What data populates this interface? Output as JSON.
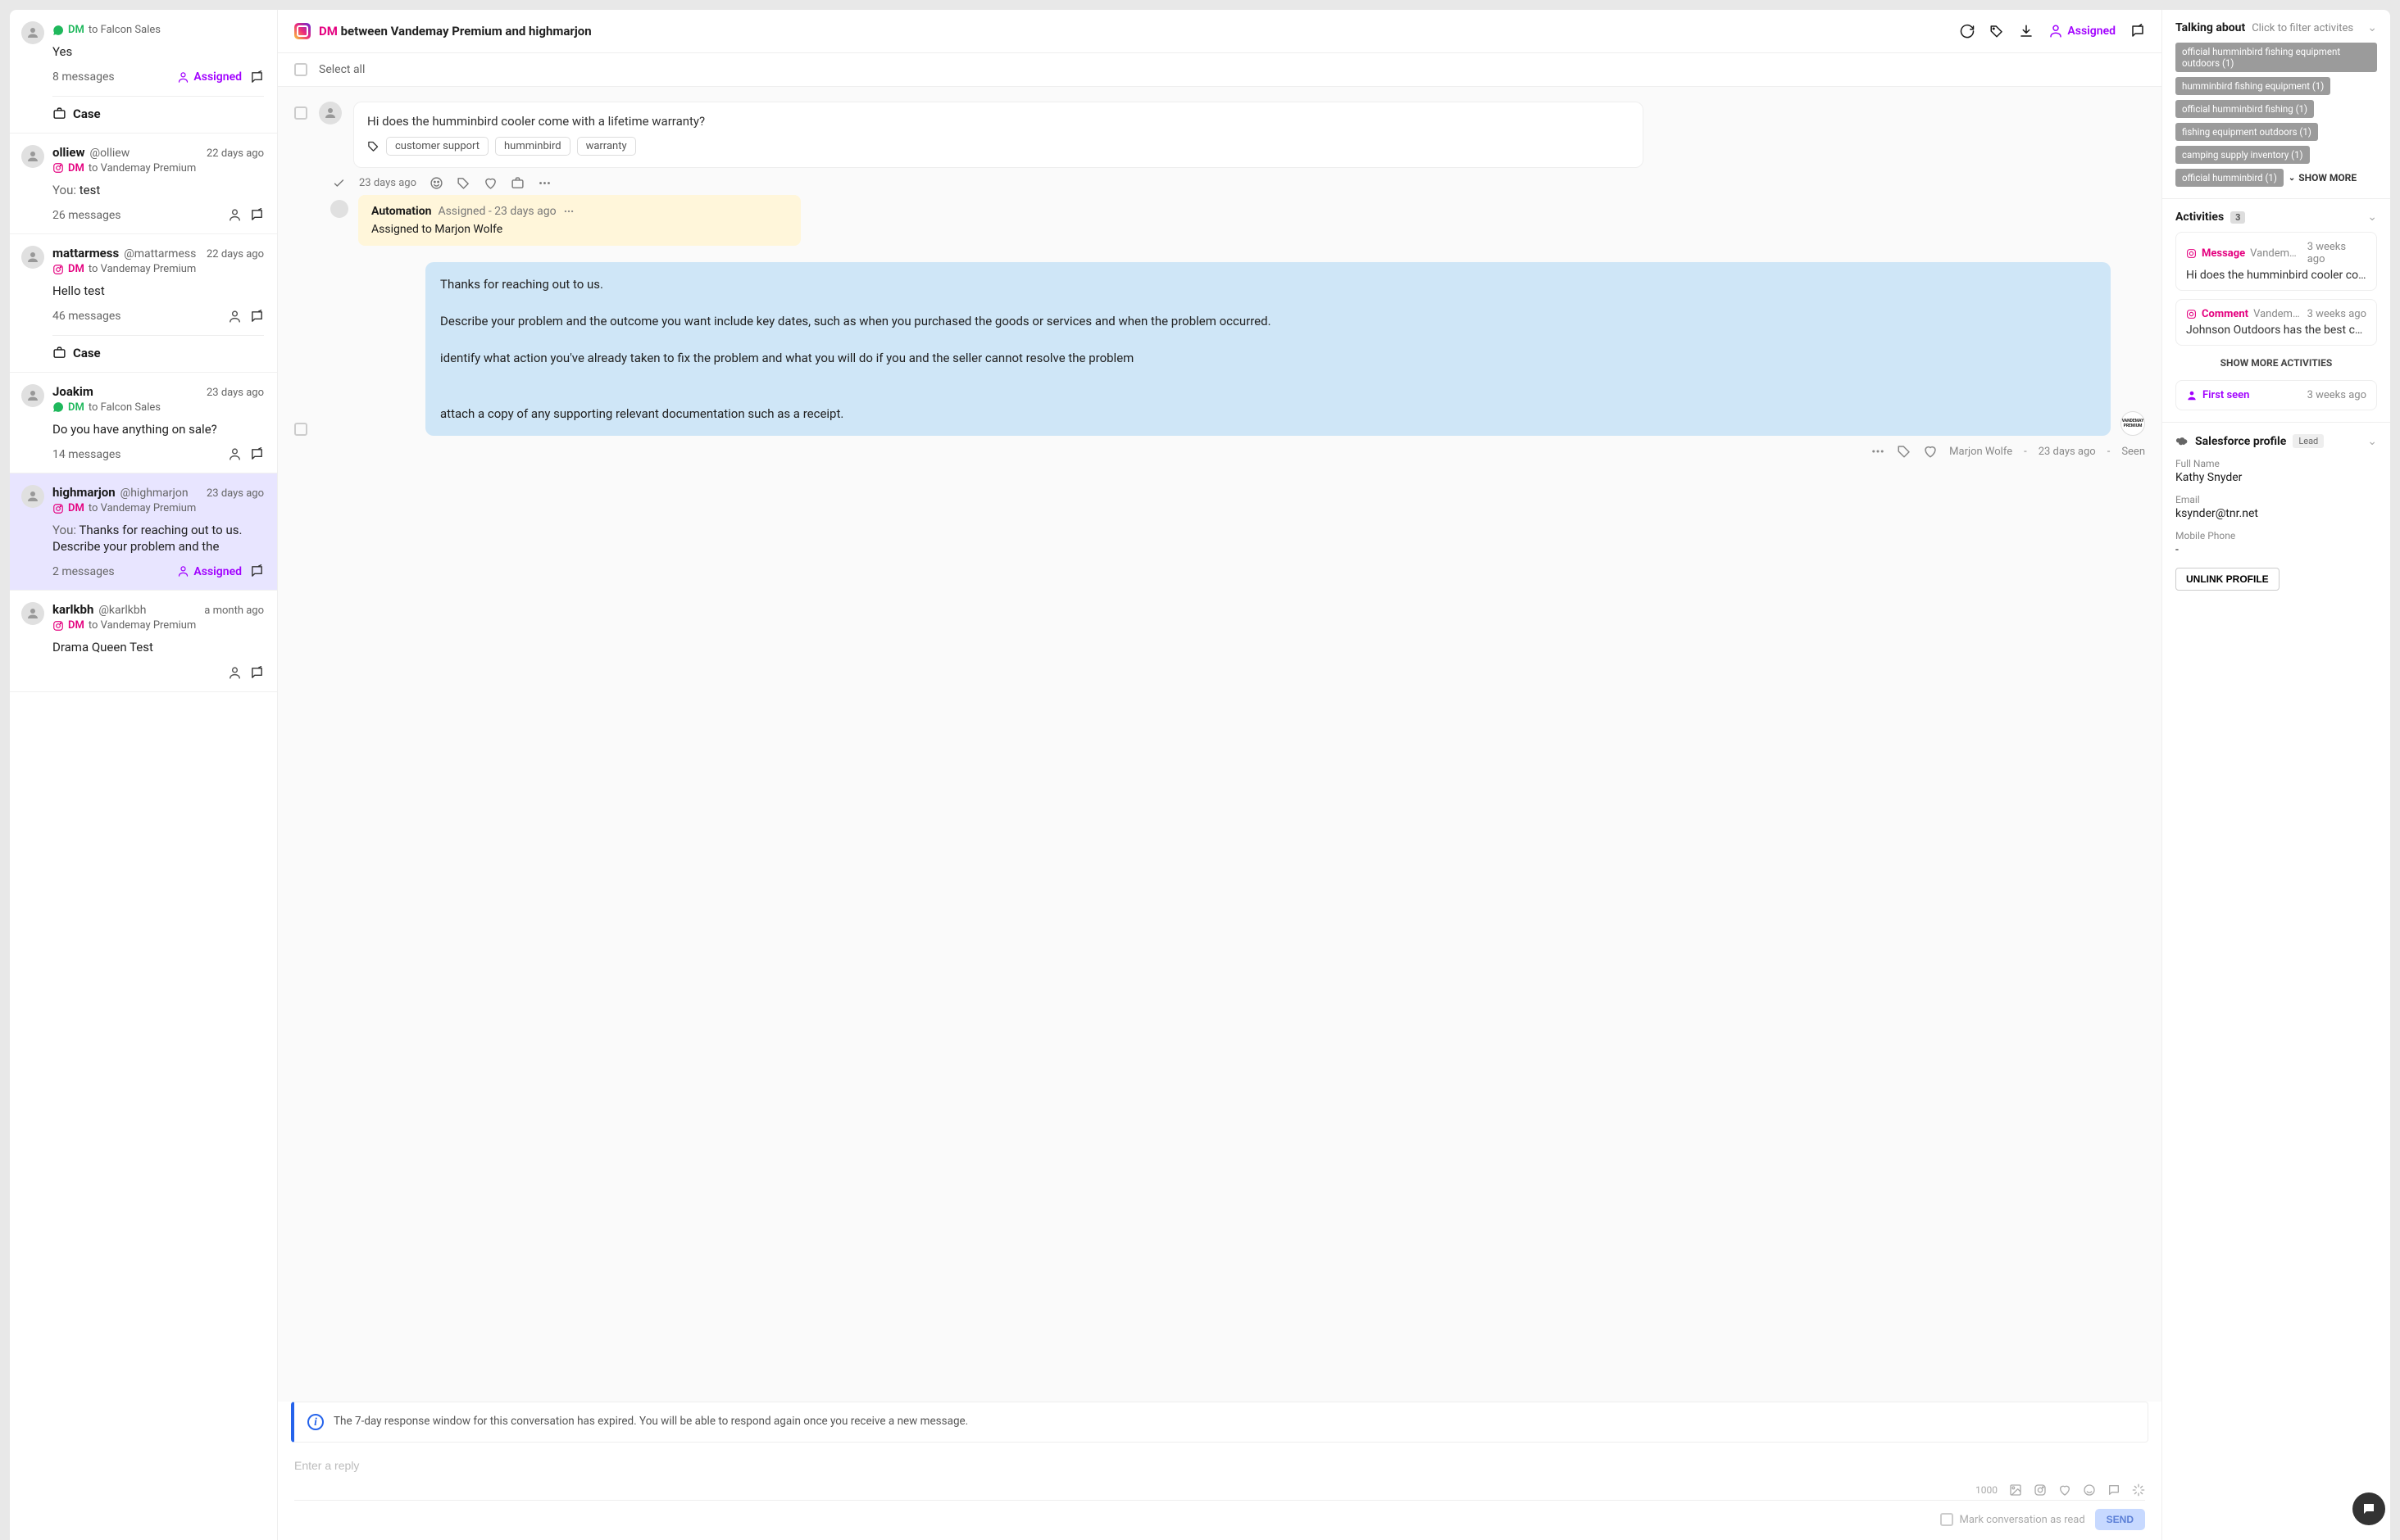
{
  "sidebar": {
    "items": [
      {
        "name": "",
        "handle": "",
        "channel": "wa",
        "channel_label": "DM",
        "to": "to Falcon Sales",
        "preview": "Yes",
        "you": false,
        "count": "8 messages",
        "time": "",
        "assigned": "Assigned",
        "case": "Case"
      },
      {
        "name": "olliew",
        "handle": "@olliew",
        "channel": "ig",
        "channel_label": "DM",
        "to": "to Vandemay Premium",
        "preview": "test",
        "you": true,
        "count": "26 messages",
        "time": "22 days ago",
        "assigned": "",
        "case": ""
      },
      {
        "name": "mattarmess",
        "handle": "@mattarmess",
        "channel": "ig",
        "channel_label": "DM",
        "to": "to Vandemay Premium",
        "preview": "Hello test",
        "you": false,
        "count": "46 messages",
        "time": "22 days ago",
        "assigned": "",
        "case": "Case"
      },
      {
        "name": "Joakim",
        "handle": "",
        "channel": "wa",
        "channel_label": "DM",
        "to": "to Falcon Sales",
        "preview": "Do you have anything on sale?",
        "you": false,
        "count": "14 messages",
        "time": "23 days ago",
        "assigned": "",
        "case": ""
      },
      {
        "name": "highmarjon",
        "handle": "@highmarjon",
        "channel": "ig",
        "channel_label": "DM",
        "to": "to Vandemay Premium",
        "preview": "Thanks for reaching out to us. Describe your problem and the",
        "you": true,
        "count": "2 messages",
        "time": "23 days ago",
        "assigned": "Assigned",
        "case": "",
        "selected": true
      },
      {
        "name": "karlkbh",
        "handle": "@karlkbh",
        "channel": "ig",
        "channel_label": "DM",
        "to": "to Vandemay Premium",
        "preview": "Drama Queen Test",
        "you": false,
        "count": "",
        "time": "a month ago",
        "assigned": "",
        "case": ""
      }
    ],
    "you_prefix": "You: "
  },
  "header": {
    "dm_label": "DM",
    "title_rest": " between Vandemay Premium and highmarjon",
    "assigned": "Assigned"
  },
  "selectall": "Select all",
  "incoming": {
    "text": "Hi does the humminbird cooler come with a lifetime warranty?",
    "tags": [
      "customer support",
      "humminbird",
      "warranty"
    ],
    "time": "23 days ago"
  },
  "automation": {
    "title": "Automation",
    "sub": "Assigned - 23 days ago",
    "body": "Assigned to Marjon Wolfe"
  },
  "outgoing": {
    "text": "Thanks for reaching out to us.\n\nDescribe your problem and the outcome you want include key dates, such as when you purchased the goods or services and when the problem occurred.\n\nidentify what action you've already taken to fix the problem and what you will do if you and the seller cannot resolve the problem\n\n\nattach a copy of any supporting relevant documentation such as a receipt.",
    "author": "Marjon Wolfe",
    "time": "23 days ago",
    "seen": "Seen",
    "avatar_label": "VANDEMAY PREMIUM"
  },
  "banner": "The 7-day response window for this conversation has expired. You will be able to respond again once you receive a new message.",
  "reply": {
    "placeholder": "Enter a reply",
    "chars": "1000",
    "mark_read": "Mark conversation as read",
    "send": "SEND"
  },
  "right": {
    "talking_title": "Talking about",
    "talking_sub": "Click to filter activites",
    "topics": [
      "official humminbird fishing equipment outdoors (1)",
      "humminbird fishing equipment (1)",
      "official humminbird fishing (1)",
      "fishing equipment outdoors (1)",
      "camping supply inventory (1)",
      "official humminbird (1)"
    ],
    "show_more": "SHOW MORE",
    "activities_title": "Activities",
    "activities_count": "3",
    "activities": [
      {
        "type": "Message",
        "from": "Vandema…",
        "time": "3 weeks ago",
        "body": "Hi does the humminbird cooler com…"
      },
      {
        "type": "Comment",
        "from": "Vandem…",
        "time": "3 weeks ago",
        "body": "Johnson Outdoors has the best cam…"
      }
    ],
    "show_more_act": "SHOW MORE ACTIVITIES",
    "first_seen_label": "First seen",
    "first_seen_time": "3 weeks ago",
    "sf_title": "Salesforce profile",
    "sf_lead": "Lead",
    "sf_fields": [
      {
        "label": "Full Name",
        "value": "Kathy Snyder"
      },
      {
        "label": "Email",
        "value": "ksynder@tnr.net"
      },
      {
        "label": "Mobile Phone",
        "value": "-"
      }
    ],
    "unlink": "UNLINK PROFILE"
  }
}
